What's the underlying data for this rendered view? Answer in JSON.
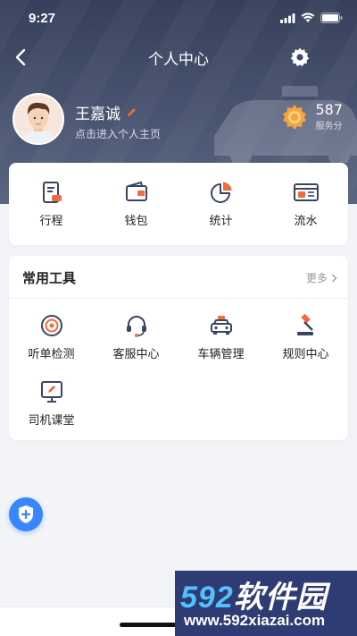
{
  "status_bar": {
    "time": "9:27"
  },
  "navbar": {
    "title": "个人中心"
  },
  "profile": {
    "name": "王嘉诚",
    "subtitle": "点击进入个人主页"
  },
  "score": {
    "value": "587",
    "label": "服务分"
  },
  "quick_actions": [
    {
      "label": "行程",
      "icon": "trip-icon"
    },
    {
      "label": "钱包",
      "icon": "wallet-icon"
    },
    {
      "label": "统计",
      "icon": "pie-chart-icon"
    },
    {
      "label": "流水",
      "icon": "cashflow-icon"
    }
  ],
  "tools": {
    "title": "常用工具",
    "more": "更多",
    "items": [
      {
        "label": "听单检测",
        "icon": "order-detect-icon"
      },
      {
        "label": "客服中心",
        "icon": "headset-icon"
      },
      {
        "label": "车辆管理",
        "icon": "car-icon"
      },
      {
        "label": "规则中心",
        "icon": "gavel-icon"
      },
      {
        "label": "司机课堂",
        "icon": "classroom-icon"
      }
    ]
  },
  "watermark": {
    "numerals": "592",
    "text": "软件园",
    "url": "www.592xiazai.com"
  },
  "colors": {
    "accent": "#f26a3d",
    "header": "#3b4560",
    "shield": "#3a86ff",
    "icon": "#3b4560"
  }
}
